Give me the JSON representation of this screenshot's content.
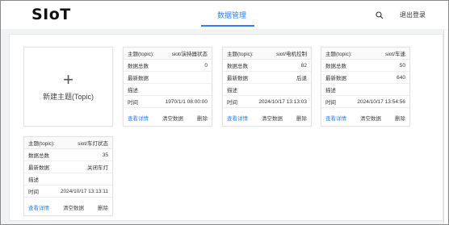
{
  "header": {
    "logo": "SIoT",
    "nav_tab": "数据管理",
    "logout": "退出登录",
    "accent": "#2d7ff9"
  },
  "new_topic": {
    "plus": "+",
    "label": "新建主题(Topic)"
  },
  "cards": [
    {
      "topic_label": "主题(topic):",
      "topic": "siot/演持器状态",
      "rows": [
        {
          "label": "数据总数",
          "value": "0"
        },
        {
          "label": "最新数据",
          "value": ""
        },
        {
          "label": "描述",
          "value": ""
        },
        {
          "label": "时间",
          "value": "1970/1/1 08:00:00"
        }
      ],
      "actions": {
        "view": "查看详情",
        "clear": "清空数据",
        "delete": "删除"
      }
    },
    {
      "topic_label": "主题(topic):",
      "topic": "siot/电机控制",
      "rows": [
        {
          "label": "数据总数",
          "value": "82"
        },
        {
          "label": "最新数据",
          "value": "后退"
        },
        {
          "label": "描述",
          "value": ""
        },
        {
          "label": "时间",
          "value": "2024/10/17 13:13:03"
        }
      ],
      "actions": {
        "view": "查看详情",
        "clear": "清空数据",
        "delete": "删除"
      }
    },
    {
      "topic_label": "主题(topic):",
      "topic": "siot/车速",
      "rows": [
        {
          "label": "数据总数",
          "value": "50"
        },
        {
          "label": "最新数据",
          "value": "640"
        },
        {
          "label": "描述",
          "value": ""
        },
        {
          "label": "时间",
          "value": "2024/10/17 13:54:56"
        }
      ],
      "actions": {
        "view": "查看详情",
        "clear": "清空数据",
        "delete": "删除"
      }
    },
    {
      "topic_label": "主题(topic):",
      "topic": "siot/车灯状态",
      "rows": [
        {
          "label": "数据总数",
          "value": "35"
        },
        {
          "label": "最新数据",
          "value": "关闭车灯"
        },
        {
          "label": "描述",
          "value": ""
        },
        {
          "label": "时间",
          "value": "2024/10/17 13:13:11"
        }
      ],
      "actions": {
        "view": "查看详情",
        "clear": "清空数据",
        "delete": "删除"
      }
    }
  ]
}
